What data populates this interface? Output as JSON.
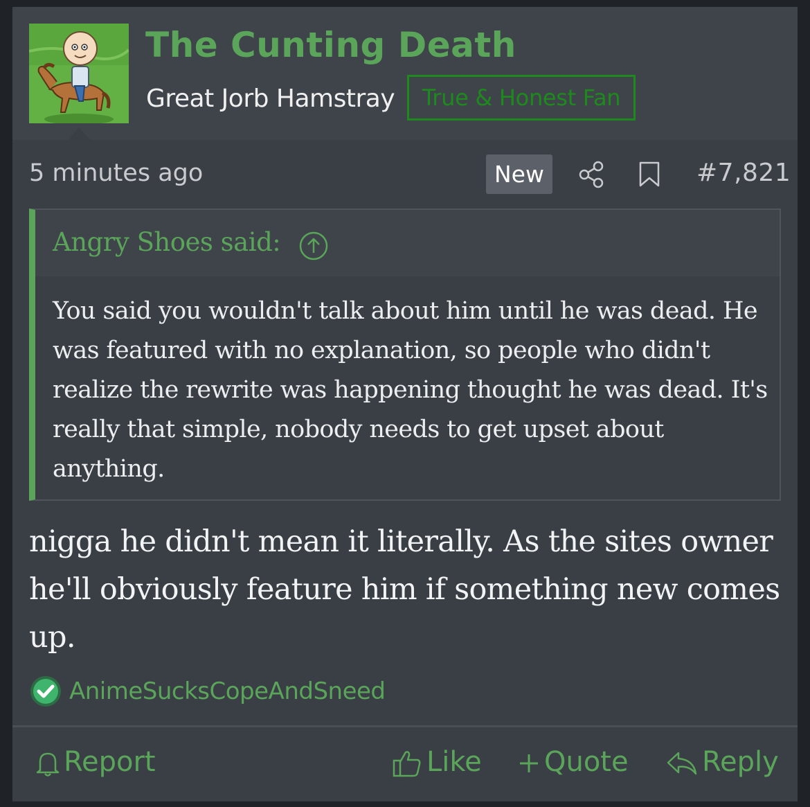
{
  "post": {
    "username": "The Cunting Death",
    "user_title": "Great Jorb Hamstray",
    "user_banner": "True & Honest Fan",
    "time": "5 minutes ago",
    "new_badge": "New",
    "post_number": "#7,821",
    "quote": {
      "author": "Angry Shoes said:",
      "text": "You said you wouldn't talk about him until he was dead. He was featured with no explanation, so people who didn't realize the rewrite was happening thought he was dead. It's really that simple, nobody needs to get upset about anything."
    },
    "message": "nigga he didn't mean it literally. As the sites owner he'll obviously feature him if something new comes up.",
    "reaction_user": "AnimeSucksCopeAndSneed",
    "actions": {
      "report": "Report",
      "like": "Like",
      "quote": "Quote",
      "reply": "Reply"
    }
  },
  "colors": {
    "accent_green": "#5aa55a",
    "banner_green": "#1e8a1e",
    "background": "#3a3e45"
  }
}
